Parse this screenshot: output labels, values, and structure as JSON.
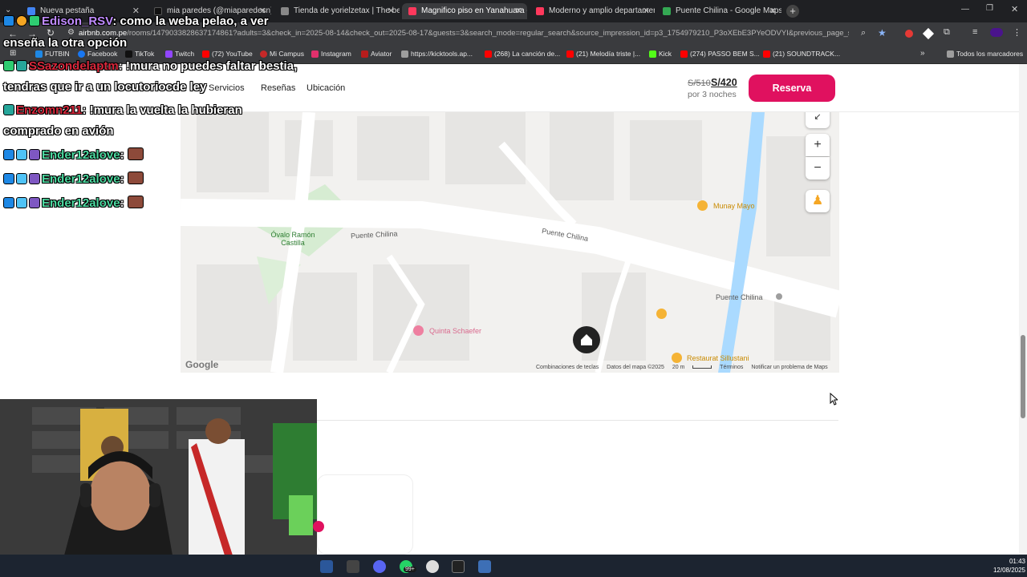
{
  "browser": {
    "tabs": [
      {
        "label": "Nueva pestaña",
        "color": "#4285f4"
      },
      {
        "label": "mia paredes (@miaparedesn) |",
        "color": "#111111"
      },
      {
        "label": "Tienda de yorielzetax | The bes",
        "color": "#888888"
      },
      {
        "label": "Magnifico piso en Yanahuara -",
        "color": "#ff385c"
      },
      {
        "label": "Moderno y amplio departamen",
        "color": "#ff385c"
      },
      {
        "label": "Puente Chilina - Google Maps",
        "color": "#34a853"
      }
    ],
    "url_host": "airbnb.com.pe",
    "url_path": "/rooms/1479033828637174861?adults=3&check_in=2025-08-14&check_out=2025-08-17&guests=3&search_mode=regular_search&source_impression_id=p3_1754979210_P3oXEbE3PYeODVYI&previous_page_sectio...",
    "bookmarks": [
      "FUTBIN",
      "Facebook",
      "TikTok",
      "Twitch",
      "(72) YouTube",
      "Mi Campus",
      "Instagram",
      "Aviator",
      "https://kicktools.ap...",
      "(268) La canción de...",
      "(21) Melodía triste |...",
      "Kick",
      "(274) PASSO BEM S...",
      "(21) SOUNDTRACK..."
    ],
    "all_bookmarks": "Todos los marcadores"
  },
  "listing": {
    "nav": [
      "Servicios",
      "Reseñas",
      "Ubicación"
    ],
    "price_old": "S/510",
    "price_new": "S/420",
    "price_nights": "por 3 noches",
    "reserve_label": "Reserva"
  },
  "map": {
    "labels": {
      "ovalo": "Óvalo Ramón Castilla",
      "puente_chilina_1": "Puente Chilina",
      "puente_chilina_2": "Puente Chilina",
      "puente_chilina_3": "Puente Chilina",
      "munay_mayo": "Munay Mayo",
      "quinta_schaefer": "Quinta Schaefer",
      "restaurant": "Restaurat Sillustani",
      "google": "Google"
    },
    "zoom_in": "+",
    "zoom_out": "−",
    "footer": {
      "shortcuts": "Combinaciones de teclas",
      "data": "Datos del mapa ©2025",
      "scale": "20 m",
      "terms": "Términos",
      "report": "Notificar un problema de Maps"
    }
  },
  "chat": [
    {
      "user": "Edison_RSV",
      "user_color": "#c08bff",
      "text": ": como la weba pelao, a ver"
    },
    {
      "user": "",
      "user_color": "#ffffff",
      "text": "enseña la otra opción"
    },
    {
      "user": "SSazondelaptm",
      "user_color": "#d9283c",
      "text": ": !mura no puedes faltar bestia,"
    },
    {
      "user": "",
      "user_color": "#ffffff",
      "text": "tendras que ir a un locutoriocde ley"
    },
    {
      "user": "Enzomn211",
      "user_color": "#d9283c",
      "text": ": !mura la vuelta la hubieran"
    },
    {
      "user": "",
      "user_color": "#ffffff",
      "text": "comprado en avión"
    },
    {
      "user": "Ender12alove",
      "user_color": "#4cd9a0",
      "text": ":"
    },
    {
      "user": "Ender12alove",
      "user_color": "#4cd9a0",
      "text": ":"
    },
    {
      "user": "Ender12alove",
      "user_color": "#4cd9a0",
      "text": ":"
    }
  ],
  "taskbar": {
    "time": "01:43",
    "date": "12/08/2025",
    "whatsapp_badge": "99+"
  }
}
